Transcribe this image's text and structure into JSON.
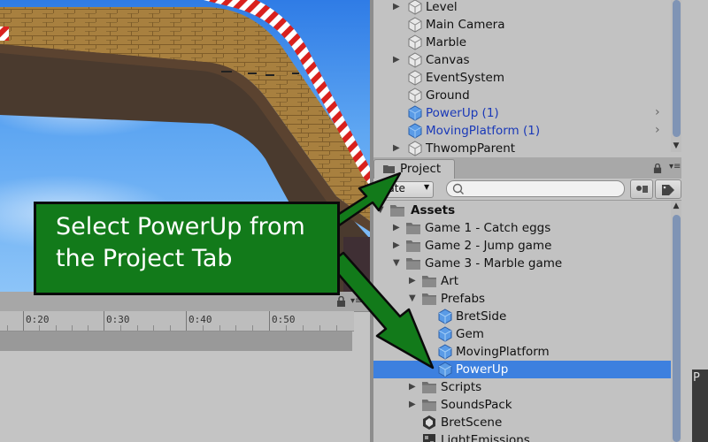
{
  "scene": {
    "description_hidden": ""
  },
  "timeline": {
    "ticks": [
      "0:20",
      "0:30",
      "0:40",
      "0:50"
    ]
  },
  "hierarchy": {
    "items": [
      {
        "label": "Level",
        "expandable": true,
        "prefab": false
      },
      {
        "label": "Main Camera",
        "expandable": false,
        "prefab": false
      },
      {
        "label": "Marble",
        "expandable": false,
        "prefab": false
      },
      {
        "label": "Canvas",
        "expandable": true,
        "prefab": false
      },
      {
        "label": "EventSystem",
        "expandable": false,
        "prefab": false
      },
      {
        "label": "Ground",
        "expandable": false,
        "prefab": false
      },
      {
        "label": "PowerUp (1)",
        "expandable": false,
        "prefab": true
      },
      {
        "label": "MovingPlatform (1)",
        "expandable": false,
        "prefab": true
      },
      {
        "label": "ThwompParent",
        "expandable": true,
        "prefab": false
      }
    ]
  },
  "project": {
    "tab_label": "Project",
    "create_label": "eate",
    "search_placeholder": "",
    "tree": [
      {
        "label": "Assets",
        "depth": 0,
        "arrow": "down",
        "icon": "folder-icon",
        "bold": true
      },
      {
        "label": "Game 1 - Catch eggs",
        "depth": 1,
        "arrow": "right",
        "icon": "folder-icon"
      },
      {
        "label": "Game 2 - Jump game",
        "depth": 1,
        "arrow": "right",
        "icon": "folder-icon"
      },
      {
        "label": "Game 3 - Marble game",
        "depth": 1,
        "arrow": "down",
        "icon": "folder-icon"
      },
      {
        "label": "Art",
        "depth": 2,
        "arrow": "right",
        "icon": "folder-icon"
      },
      {
        "label": "Prefabs",
        "depth": 2,
        "arrow": "down",
        "icon": "folder-icon"
      },
      {
        "label": "BretSide",
        "depth": 3,
        "arrow": "",
        "icon": "prefab-cube-icon"
      },
      {
        "label": "Gem",
        "depth": 3,
        "arrow": "",
        "icon": "prefab-cube-icon"
      },
      {
        "label": "MovingPlatform",
        "depth": 3,
        "arrow": "",
        "icon": "prefab-cube-icon"
      },
      {
        "label": "PowerUp",
        "depth": 3,
        "arrow": "",
        "icon": "prefab-cube-icon",
        "selected": true
      },
      {
        "label": "Scripts",
        "depth": 2,
        "arrow": "right",
        "icon": "folder-icon"
      },
      {
        "label": "SoundsPack",
        "depth": 2,
        "arrow": "right",
        "icon": "folder-icon"
      },
      {
        "label": "BretScene",
        "depth": 2,
        "arrow": "",
        "icon": "unity-scene-icon"
      },
      {
        "label": "LightEmissions",
        "depth": 2,
        "arrow": "",
        "icon": "texture-icon"
      }
    ]
  },
  "right_panel_label": "P",
  "callout": {
    "text": "Select PowerUp from the Project Tab"
  },
  "colors": {
    "selection": "#3d80df",
    "prefab_text": "#1a39b8",
    "callout_bg": "#127a1a",
    "arrow_green": "#127a1a"
  }
}
